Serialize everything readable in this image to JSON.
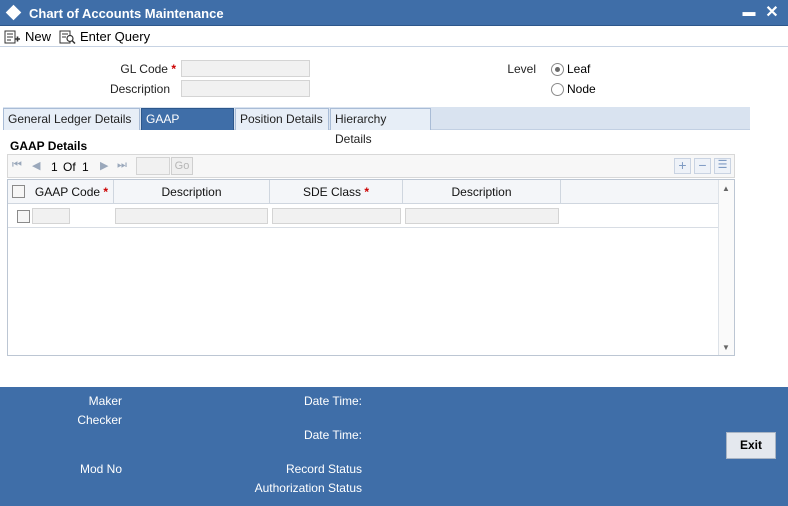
{
  "window": {
    "title": "Chart of Accounts Maintenance",
    "minimize_glyph": "▬",
    "close_glyph": "✕"
  },
  "toolbar": {
    "new_label": "New",
    "enter_query_label": "Enter Query"
  },
  "form": {
    "gl_code_label": "GL Code",
    "gl_code_value": "",
    "description_label": "Description",
    "description_value": "",
    "required_mark": "*",
    "level_label": "Level",
    "level_options": [
      {
        "label": "Leaf",
        "selected": true
      },
      {
        "label": "Node",
        "selected": false
      }
    ]
  },
  "tabs": [
    {
      "label": "General Ledger Details",
      "active": false
    },
    {
      "label": "GAAP Linkages",
      "active": true
    },
    {
      "label": "Position Details",
      "active": false
    },
    {
      "label": "Hierarchy Details",
      "active": false
    }
  ],
  "gaap": {
    "section_title": "GAAP Details",
    "pager": {
      "current": "1",
      "of_label": "Of",
      "total": "1",
      "go_label": "Go"
    },
    "columns": [
      {
        "label": "GAAP Code",
        "required": true
      },
      {
        "label": "Description",
        "required": false
      },
      {
        "label": "SDE Class",
        "required": true
      },
      {
        "label": "Description",
        "required": false
      }
    ],
    "rows": [
      {
        "gaap_code": "",
        "description": "",
        "sde_class": "",
        "sde_description": ""
      }
    ]
  },
  "footer": {
    "maker_label": "Maker",
    "checker_label": "Checker",
    "date_time_label_1": "Date Time:",
    "date_time_label_2": "Date Time:",
    "mod_no_label": "Mod No",
    "record_status_label": "Record Status",
    "authorization_status_label": "Authorization Status",
    "exit_label": "Exit"
  },
  "colors": {
    "brand_blue": "#3f6ea8",
    "required_red": "#cc0000",
    "tab_strip": "#d9e3f0"
  }
}
